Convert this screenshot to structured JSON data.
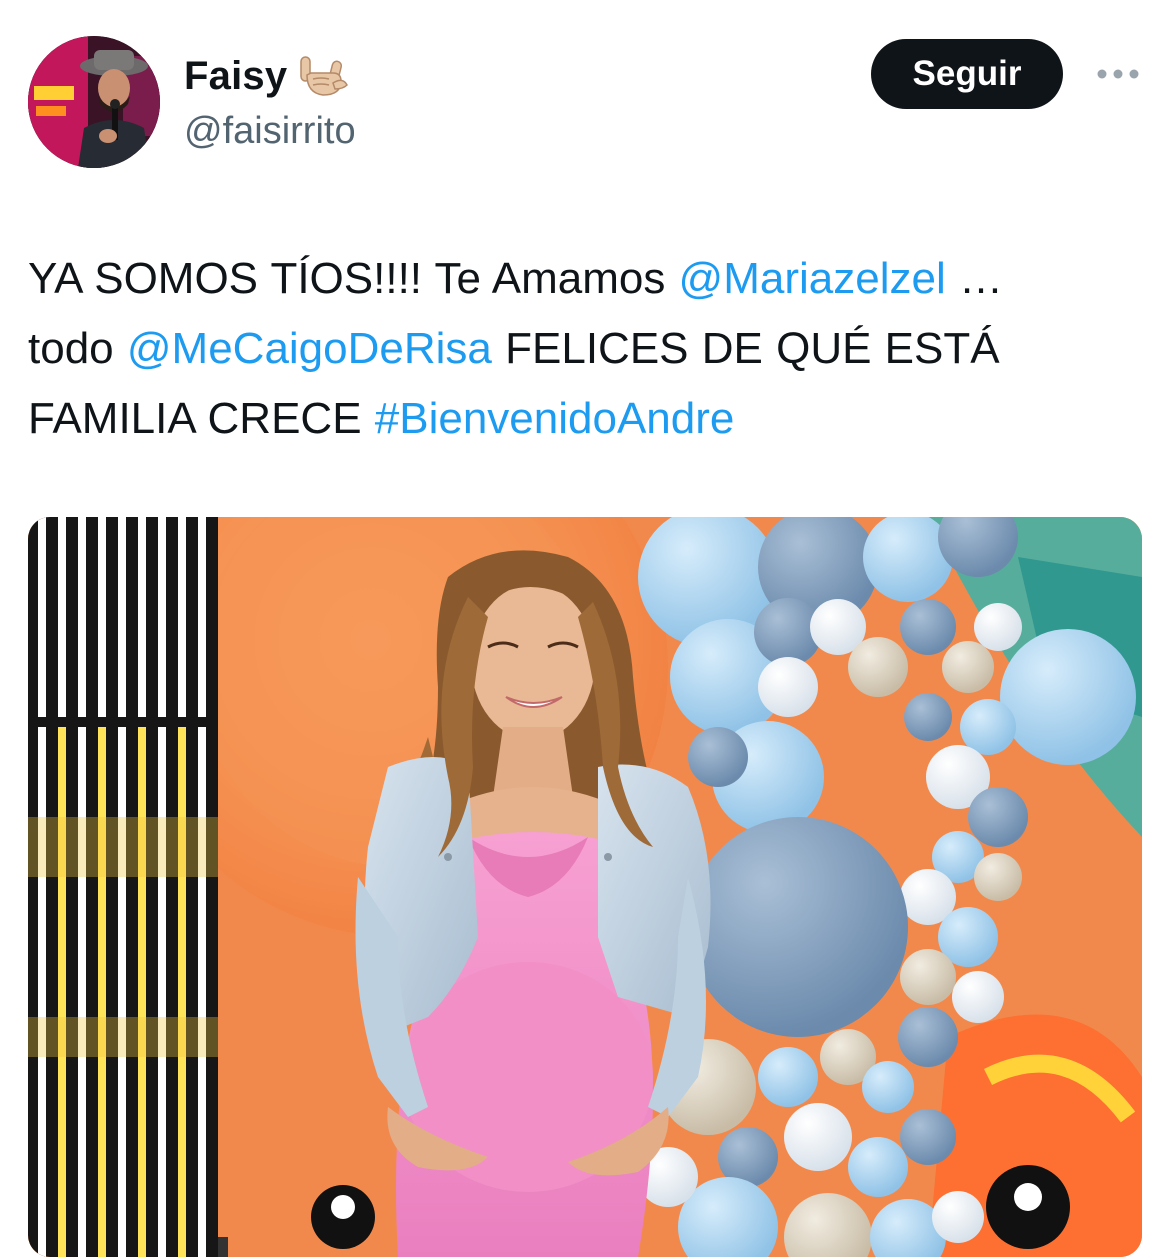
{
  "author": {
    "display_name": "Faisy",
    "handle": "@faisirrito",
    "verified_emoji": "sign-of-the-horns"
  },
  "header": {
    "follow_label": "Seguir",
    "more_icon": "more-horizontal-icon"
  },
  "tweet": {
    "line1_text": "YA SOMOS TÍOS!!!! Te Amamos ",
    "mention1": "@Mariazelzel",
    "line1_end": " …",
    "line2_start": "todo ",
    "mention2": "@MeCaigoDeRisa",
    "line2_end": " FELICES DE QUÉ ESTÁ",
    "line3_start": "FAMILIA CRECE ",
    "hashtag": "#BienvenidoAndre"
  },
  "media": {
    "kind": "photo",
    "subject": "pregnant-woman-with-balloons"
  },
  "colors": {
    "link": "#1d9bf0",
    "text": "#0f1419",
    "secondary": "#536471",
    "button_bg": "#0f1419"
  }
}
